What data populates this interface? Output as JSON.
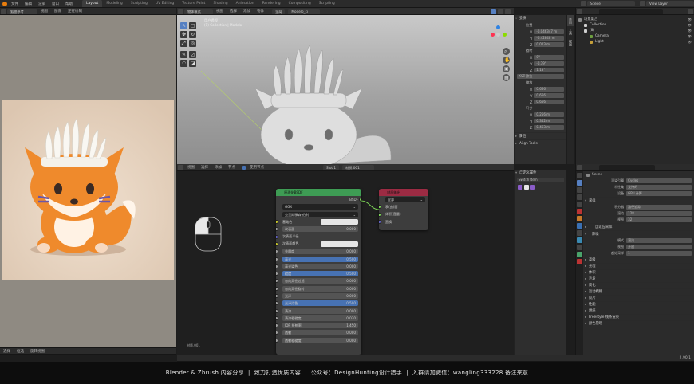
{
  "topbar": {
    "menus": [
      "文件",
      "编辑",
      "渲染",
      "窗口",
      "帮助"
    ],
    "workspaces": [
      "Layout",
      "Modeling",
      "Sculpting",
      "UV Editing",
      "Texture Paint",
      "Shading",
      "Animation",
      "Rendering",
      "Compositing",
      "Scripting"
    ],
    "active_workspace": "Layout",
    "scene_label": "Scene",
    "view_layer_label": "View Layer"
  },
  "image_editor": {
    "header_items": [
      "视图",
      "图像",
      "正在绘制"
    ],
    "image_name": "狐狸参考"
  },
  "viewport": {
    "header_menus": [
      "视图",
      "选择",
      "添加",
      "物体"
    ],
    "mode": "物体模式",
    "object_name": "Modelo_ci",
    "orientation": "全局",
    "overlay_text": [
      "用户透视",
      "(1) Collection | Modelo"
    ],
    "n_panel": {
      "title": "变换",
      "location_label": "位置",
      "location": [
        "-0.046347 m",
        "-0.42848 m",
        "0.003 m"
      ],
      "rotation_label": "旋转",
      "rotation": [
        "0°",
        "-0.39°",
        "1.13°"
      ],
      "mode_label": "XYZ 欧拉",
      "scale_label": "缩放",
      "scale": [
        "0.666",
        "0.666",
        "0.666"
      ],
      "dimensions_label": "尺寸",
      "dimensions": [
        "0.256 m",
        "0.342 m",
        "0.463 m"
      ],
      "sections": [
        "属性",
        "Align Tools"
      ]
    },
    "side_tabs": [
      "条目",
      "工具",
      "视图"
    ]
  },
  "node_editor": {
    "header_menus": [
      "视图",
      "选择",
      "添加",
      "节点"
    ],
    "use_nodes_label": "使用节点",
    "slot_label": "Slot 1",
    "material_name": "材质.001",
    "footer_label": "材质.001",
    "bsdf": {
      "title": "原理化BSDF",
      "output_label": "BSDF",
      "distribution": "GGX",
      "subsurface_method": "克里斯滕森-伯利",
      "rows": [
        {
          "label": "基础色",
          "type": "color",
          "socket": "yellow"
        },
        {
          "label": "次表面",
          "value": "0.000",
          "socket": "grey"
        },
        {
          "label": "次表面半径",
          "value": "",
          "type": "vector",
          "socket": "blue"
        },
        {
          "label": "次表面颜色",
          "type": "color",
          "socket": "yellow"
        },
        {
          "label": "金属度",
          "value": "0.000",
          "socket": "grey"
        },
        {
          "label": "高光",
          "value": "0.500",
          "hl": true,
          "socket": "grey"
        },
        {
          "label": "高光染色",
          "value": "0.000",
          "socket": "grey"
        },
        {
          "label": "糙度",
          "value": "0.500",
          "hl": true,
          "socket": "grey"
        },
        {
          "label": "各向异性过滤",
          "value": "0.000",
          "socket": "grey"
        },
        {
          "label": "各向异性旋转",
          "value": "0.000",
          "socket": "grey"
        },
        {
          "label": "光泽",
          "value": "0.000",
          "socket": "grey"
        },
        {
          "label": "光泽染色",
          "value": "0.500",
          "hl": true,
          "socket": "grey"
        },
        {
          "label": "清漆",
          "value": "0.000",
          "socket": "grey"
        },
        {
          "label": "清漆粗糙度",
          "value": "0.030",
          "socket": "grey"
        },
        {
          "label": "IOR 折射率",
          "value": "1.450",
          "socket": "grey"
        },
        {
          "label": "透射",
          "value": "0.000",
          "socket": "grey"
        },
        {
          "label": "透射粗糙度",
          "value": "0.000",
          "socket": "grey"
        }
      ]
    },
    "output": {
      "title": "材质输出",
      "target": "全部",
      "inputs": [
        "表(曲)面",
        "体积(音量)",
        "置换"
      ]
    },
    "side_panel": {
      "title": "自定义属性",
      "item": "Switch Item"
    }
  },
  "outliner": {
    "title": "场景集合",
    "items": [
      {
        "name": "场景集合",
        "indent": 0,
        "color": "#8a8a8a"
      },
      {
        "name": "Collection",
        "indent": 1,
        "color": "#d0d0d0"
      },
      {
        "name": "(8)",
        "indent": 1,
        "color": "#d0d0d0"
      },
      {
        "name": "Camera",
        "indent": 2,
        "color": "#6d9e3f"
      },
      {
        "name": "Light",
        "indent": 2,
        "color": "#c59f3a"
      }
    ]
  },
  "properties": {
    "scene_name": "Scene",
    "rows": [
      {
        "label": "渲染引擎",
        "value": "Cycles"
      },
      {
        "label": "特性集",
        "value": "支持的"
      },
      {
        "label": "设备",
        "value": "GPU 计算"
      }
    ],
    "sampling_label": "采样",
    "sampling_rows": [
      {
        "label": "积分器",
        "value": "路径追踪"
      },
      {
        "label": "渲染",
        "value": "128"
      },
      {
        "label": "视图",
        "value": "32"
      }
    ],
    "sub_labels": [
      "自适应采样",
      "降噪"
    ],
    "extra_rows": [
      {
        "label": "模式",
        "value": "渲染"
      },
      {
        "label": "视图",
        "value": "开启"
      },
      {
        "label": "起始采样",
        "value": "1"
      }
    ],
    "sections": [
      "高级",
      "光程",
      "体积",
      "毛发",
      "简化",
      "运动模糊",
      "胶片",
      "性能",
      "烘焙",
      "Freestyle 线条渲染",
      "颜色管理"
    ]
  },
  "status_bar": {
    "left_items": [
      "选择",
      "框选",
      "旋转视图"
    ],
    "right_text": "2.90.1"
  },
  "banner": {
    "text": "Blender & Zbrush 内容分享  |  致力打造优质内容  |  公众号：DesignHunting设计猎手  |  入群请加微信：wangling333228 备注来意"
  },
  "colors": {
    "accent": "#4772b3",
    "node_shader_header": "#3e9c54",
    "node_output_header": "#9c2b43",
    "socket_yellow": "#c7c729",
    "socket_grey": "#a1a1a1",
    "socket_blue": "#6363c7",
    "bg_dark": "#1d1d1d",
    "ref_bg": "#e9d7c4"
  }
}
